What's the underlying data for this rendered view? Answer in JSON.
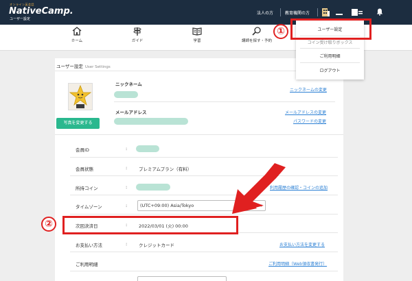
{
  "header": {
    "logo_small": "オンライン英会話",
    "logo_main": "NativeCamp.",
    "logo_sub": "ユーザー設定",
    "links": [
      "法人の方",
      "教育機関の方"
    ],
    "icons": [
      "building-icon",
      "minus-icon",
      "card-icon",
      "bell-icon"
    ]
  },
  "nav": {
    "items": [
      {
        "label": "ホーム",
        "icon": "home-icon"
      },
      {
        "label": "ガイド",
        "icon": "signpost-icon"
      },
      {
        "label": "学習",
        "icon": "book-icon"
      },
      {
        "label": "講師を探す・予約",
        "icon": "search-icon"
      }
    ]
  },
  "dropdown": {
    "items": [
      "ユーザー設定",
      "コイン受け取りボックス",
      "ご利用明細",
      "ログアウト"
    ]
  },
  "annotations": {
    "num1": "①",
    "num2": "②"
  },
  "card": {
    "title": "ユーザー設定",
    "title_en": "User Settings",
    "photo_button": "写真を変更する",
    "nickname_label": "ニックネーム",
    "nickname_link": "ニックネームの変更",
    "email_label": "メールアドレス",
    "email_link": "メールアドレスの変更",
    "password_link": "パスワードの変更",
    "colon": ":",
    "rows": [
      {
        "label": "会員ID",
        "value": "",
        "link": ""
      },
      {
        "label": "会員状態",
        "value": "プレミアムプラン（有料）",
        "link": ""
      },
      {
        "label": "所持コイン",
        "value": "",
        "link": "利用履歴の確認・コインの追加"
      },
      {
        "label": "タイムゾーン",
        "value": "(UTC+09:00) Asia/Tokyo",
        "link": ""
      },
      {
        "label": "次回決済日",
        "value": "2022/03/01 (火) 00:00",
        "link": ""
      },
      {
        "label": "お支払い方法",
        "value": "クレジットカード",
        "link": "お支払い方法を変更する"
      },
      {
        "label": "ご利用明細",
        "value": "",
        "link": "ご利用明細（Web領収書発行）"
      },
      {
        "label": "",
        "value": "",
        "link": ""
      }
    ]
  },
  "colors": {
    "header_bg": "#1c2d40",
    "accent_green": "#2ab88e",
    "link_blue": "#2a7fd4",
    "annotation_red": "#e02020"
  }
}
